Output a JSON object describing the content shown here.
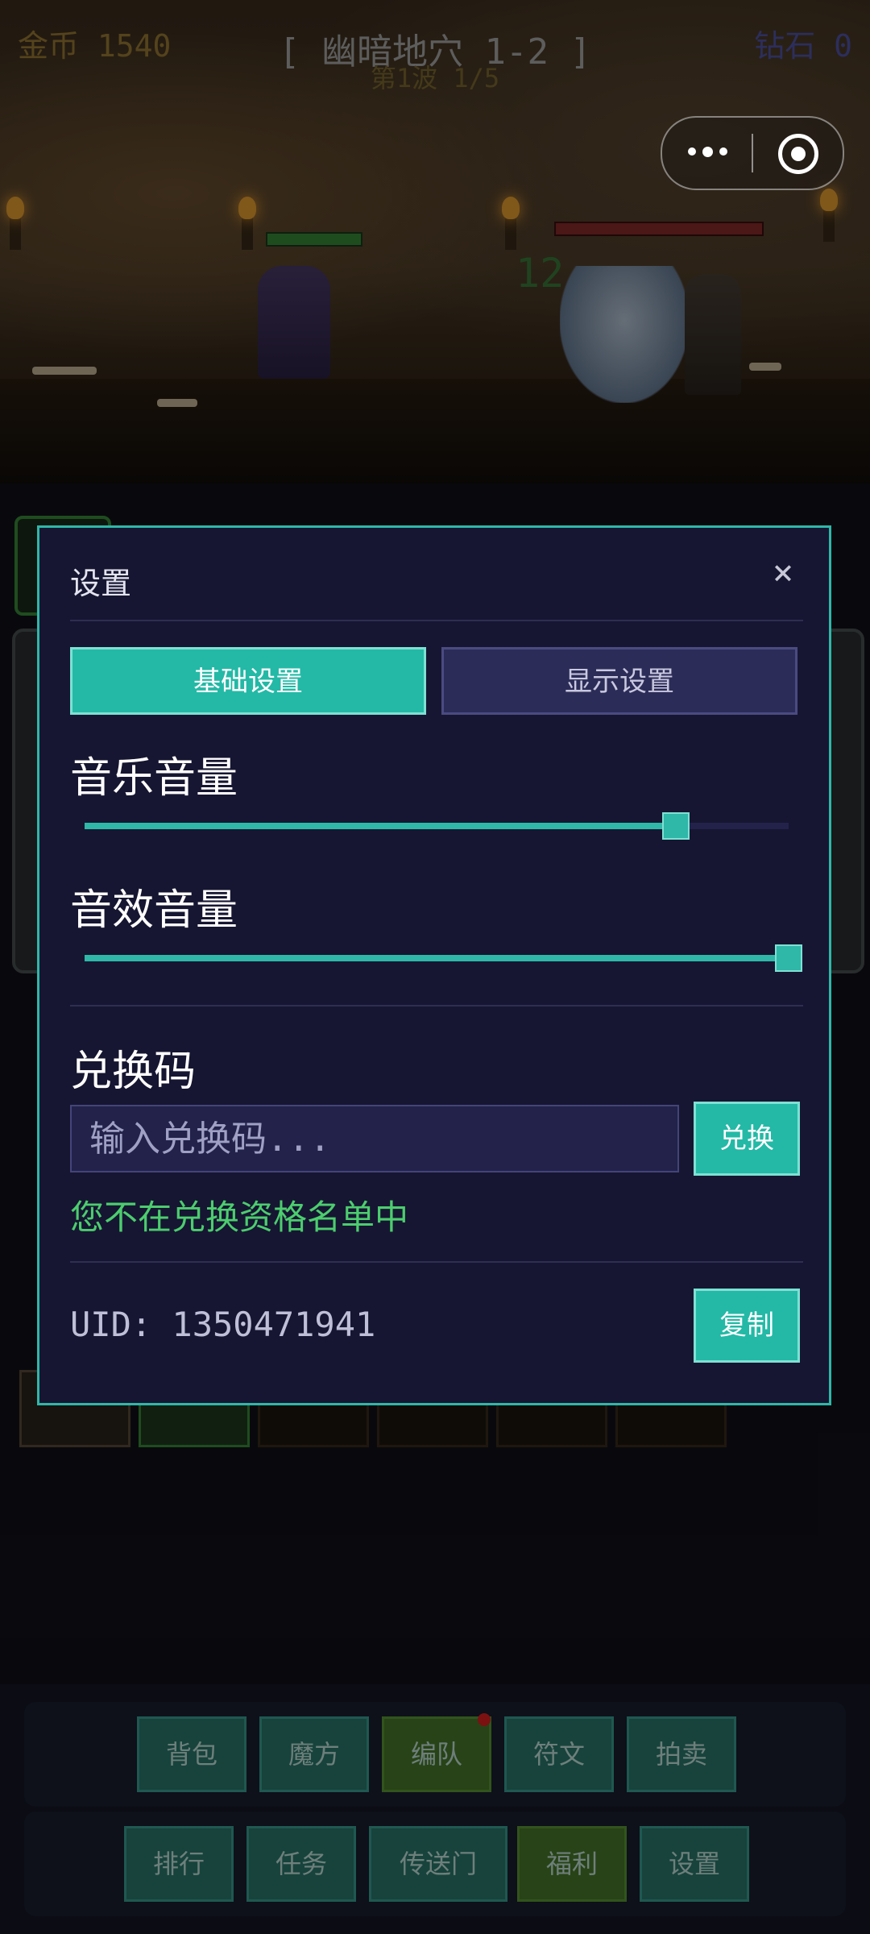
{
  "hud": {
    "gold": "金币 1540",
    "stage": "[ 幽暗地穴 1-2 ]",
    "wave": "第1波 1/5",
    "diamonds": "钻石 0"
  },
  "scene": {
    "damage_number": "12"
  },
  "settings_modal": {
    "title": "设置",
    "close_icon": "close-icon",
    "tabs": [
      {
        "label": "基础设置",
        "active": true
      },
      {
        "label": "显示设置",
        "active": false
      }
    ],
    "music_volume": {
      "label": "音乐音量",
      "value": 0.84
    },
    "sfx_volume": {
      "label": "音效音量",
      "value": 1.0
    },
    "redeem": {
      "label": "兑换码",
      "placeholder": "输入兑换码...",
      "button": "兑换",
      "status": "您不在兑换资格名单中"
    },
    "uid": {
      "text": "UID: 1350471941",
      "copy_button": "复制"
    }
  },
  "bottom_nav": {
    "row1": [
      "背包",
      "魔方",
      "编队",
      "符文",
      "拍卖"
    ],
    "row2": [
      "排行",
      "任务",
      "传送门",
      "福利",
      "设置"
    ]
  },
  "colors": {
    "accent": "#23b9a6",
    "modal_bg": "#161632",
    "status_green": "#4ccd6e"
  }
}
